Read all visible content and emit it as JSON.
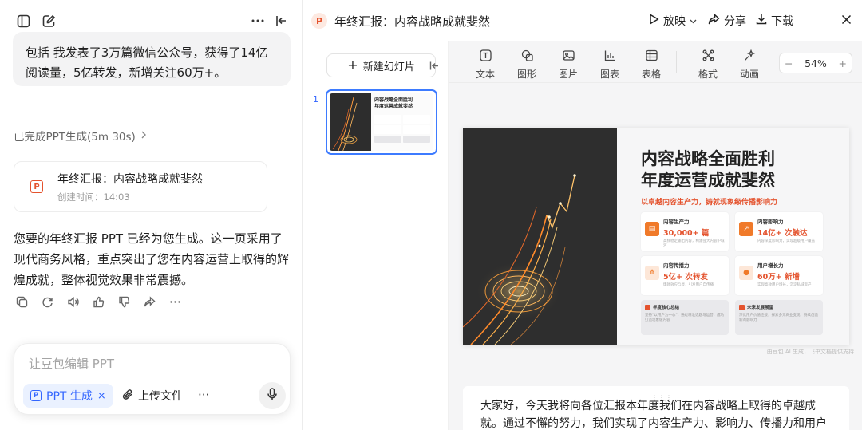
{
  "chat": {
    "prev_bubble": "包括 我发表了3万篇微信公众号，获得了14亿阅读量，5亿转发，新增关注60万+。",
    "status": "已完成PPT生成(5m 30s)",
    "card": {
      "title": "年终汇报：内容战略成就斐然",
      "created": "创建时间：14:03"
    },
    "reply": "您要的年终汇报 PPT 已经为您生成。这一页采用了现代商务风格，重点突出了您在内容运营上取得的辉煌成就，整体视觉效果非常震撼。",
    "composer": {
      "placeholder": "让豆包编辑 PPT",
      "chip": "PPT 生成",
      "upload": "上传文件",
      "more": "···"
    }
  },
  "header": {
    "logo": "P",
    "title": "年终汇报：内容战略成就斐然",
    "play": "放映",
    "share": "分享",
    "download": "下载"
  },
  "slides_panel": {
    "new_slide": "新建幻灯片",
    "slide_number": "1"
  },
  "toolbar": {
    "items": [
      "文本",
      "图形",
      "图片",
      "图表",
      "表格",
      "格式",
      "动画"
    ],
    "zoom": "54%"
  },
  "slide": {
    "title_line1": "内容战略全面胜利",
    "title_line2": "年度运营成就斐然",
    "subtitle": "以卓越内容生产力，铸就现象级传播影响力",
    "boxes": [
      {
        "label": "内容生产力",
        "value": "30,000+ 篇",
        "desc": "高频稳定输出内容，构建强大内容护城河"
      },
      {
        "label": "内容影响力",
        "value": "14亿+ 次触达",
        "desc": "内容深度影响力，实现超级用户覆盖"
      },
      {
        "label": "内容传播力",
        "value": "5亿+ 次转发",
        "desc": "爆款效应凸显，引发用户自传播"
      },
      {
        "label": "用户增长力",
        "value": "60万+ 新增",
        "desc": "实现高效用户增长，沉淀私域资产"
      }
    ],
    "bottom": [
      {
        "label": "年度核心总结",
        "desc": "坚持“以用户为中心”，通过精准选题与运营，成功打造现象级内容"
      },
      {
        "label": "未来发展展望",
        "desc": "深化用户价值连接，探索多元商业变现，持续创造新的影响力"
      }
    ],
    "footer": "由豆包 AI 生成，飞书文档提供支持"
  },
  "notes": "大家好，今天我将向各位汇报本年度我们在内容战略上取得的卓越成就。通过不懈的努力，我们实现了内容生产力、影响力、传播力和用户增长力的全"
}
